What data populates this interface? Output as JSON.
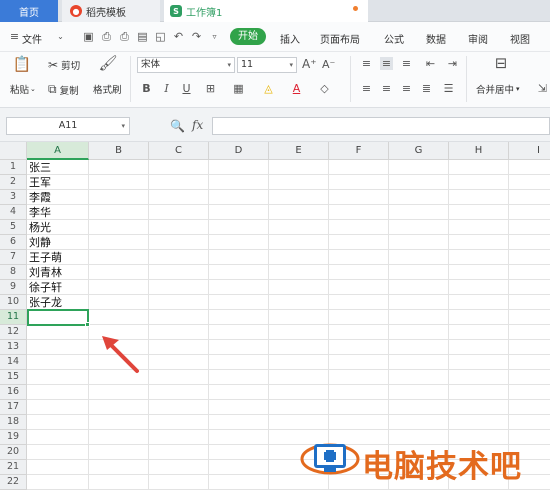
{
  "tabs": [
    {
      "label": "首页"
    },
    {
      "label": "稻壳模板",
      "icon": "docer-icon"
    },
    {
      "label": "工作簿1",
      "icon": "sheet-icon"
    }
  ],
  "menu": {
    "file_label": "文件",
    "start_label": "开始",
    "items": [
      "插入",
      "页面布局",
      "公式",
      "数据",
      "审阅",
      "视图"
    ]
  },
  "ribbon": {
    "format_painter_label": "格式刷",
    "cut_label": "剪切",
    "copy_label": "复制",
    "paste_label": "粘贴",
    "font_name": "宋体",
    "font_size": "11",
    "merge_label": "合并居中"
  },
  "formula_bar": {
    "name_box": "A11",
    "fx_label": "fx",
    "formula": ""
  },
  "columns": [
    "A",
    "B",
    "C",
    "D",
    "E",
    "F",
    "G",
    "H",
    "I"
  ],
  "rows": [
    "1",
    "2",
    "3",
    "4",
    "5",
    "6",
    "7",
    "8",
    "9",
    "10",
    "11",
    "12",
    "13",
    "14",
    "15",
    "16",
    "17",
    "18",
    "19",
    "20",
    "21",
    "22"
  ],
  "cells_a": [
    "张三",
    "王军",
    "李霞",
    "李华",
    "杨光",
    "刘静",
    "王子萌",
    "刘青林",
    "徐子轩",
    "张子龙"
  ],
  "selected_cell": "A11",
  "watermark": {
    "text": "电脑技术吧"
  },
  "colors": {
    "accent_green": "#31a34a",
    "home_tab": "#3b7bd8",
    "arrow": "#e0453b",
    "watermark": "#e36a1e"
  }
}
